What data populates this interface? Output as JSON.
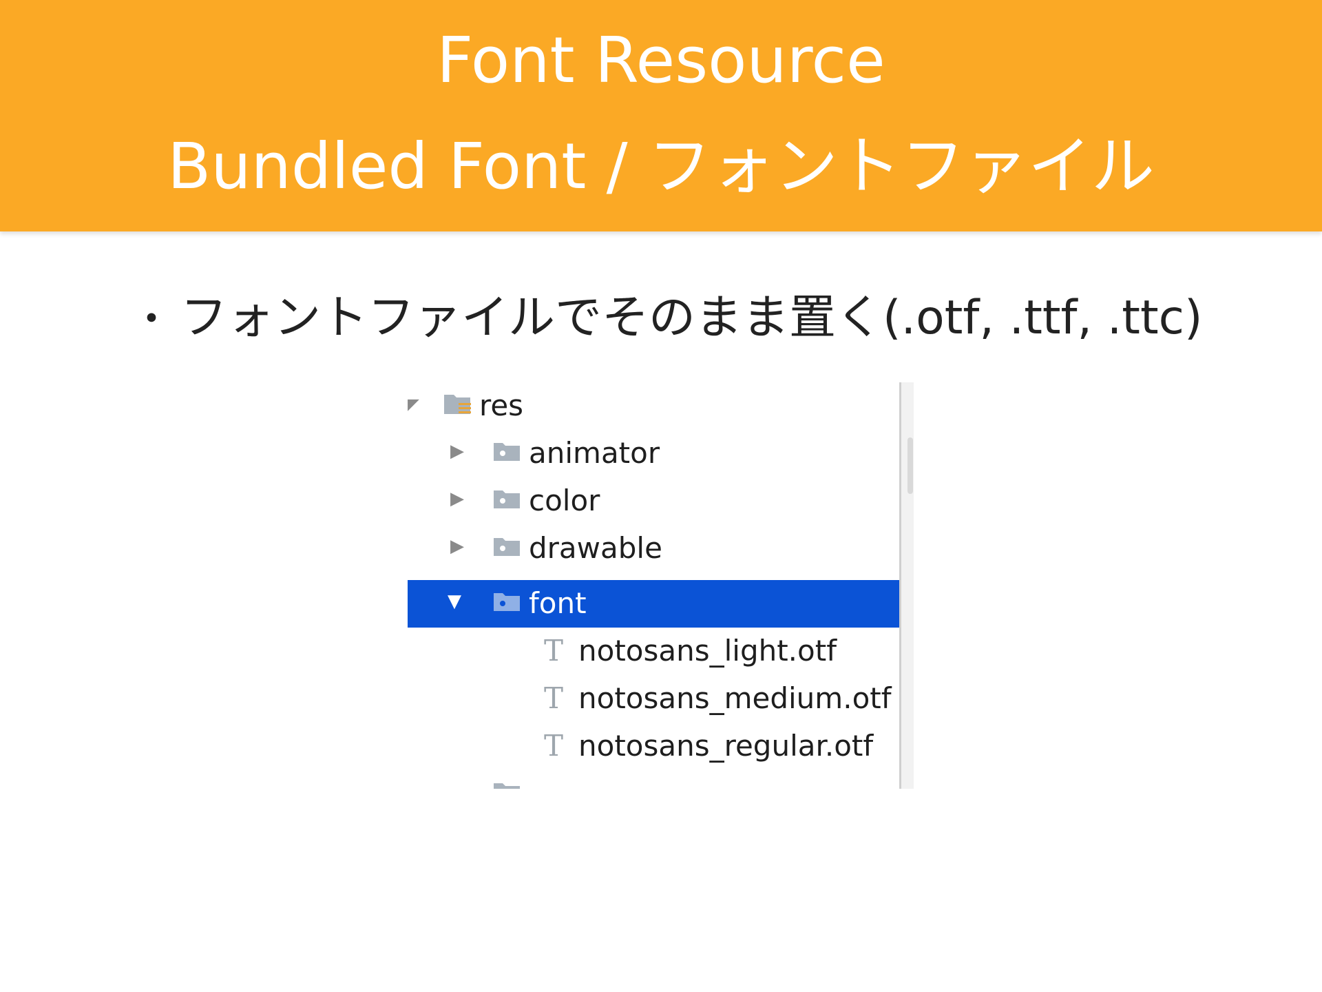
{
  "header": {
    "title_line1": "Font Resource",
    "title_line2": "Bundled Font / フォントファイル",
    "background_color": "#FBA925"
  },
  "bullet": {
    "marker": "・",
    "text": "フォントファイルでそのまま置く(.otf, .ttf, .ttc)"
  },
  "tree": {
    "root": {
      "label": "res",
      "icon": "res-folder-icon",
      "expanded": true
    },
    "folders": [
      {
        "label": "animator",
        "expanded": false,
        "selected": false
      },
      {
        "label": "color",
        "expanded": false,
        "selected": false
      },
      {
        "label": "drawable",
        "expanded": false,
        "selected": false
      },
      {
        "label": "font",
        "expanded": true,
        "selected": true
      }
    ],
    "files": [
      {
        "label": "notosans_light.otf",
        "icon": "font-file-icon"
      },
      {
        "label": "notosans_medium.otf",
        "icon": "font-file-icon"
      },
      {
        "label": "notosans_regular.otf",
        "icon": "font-file-icon"
      }
    ],
    "selection_color": "#0B53D6"
  }
}
